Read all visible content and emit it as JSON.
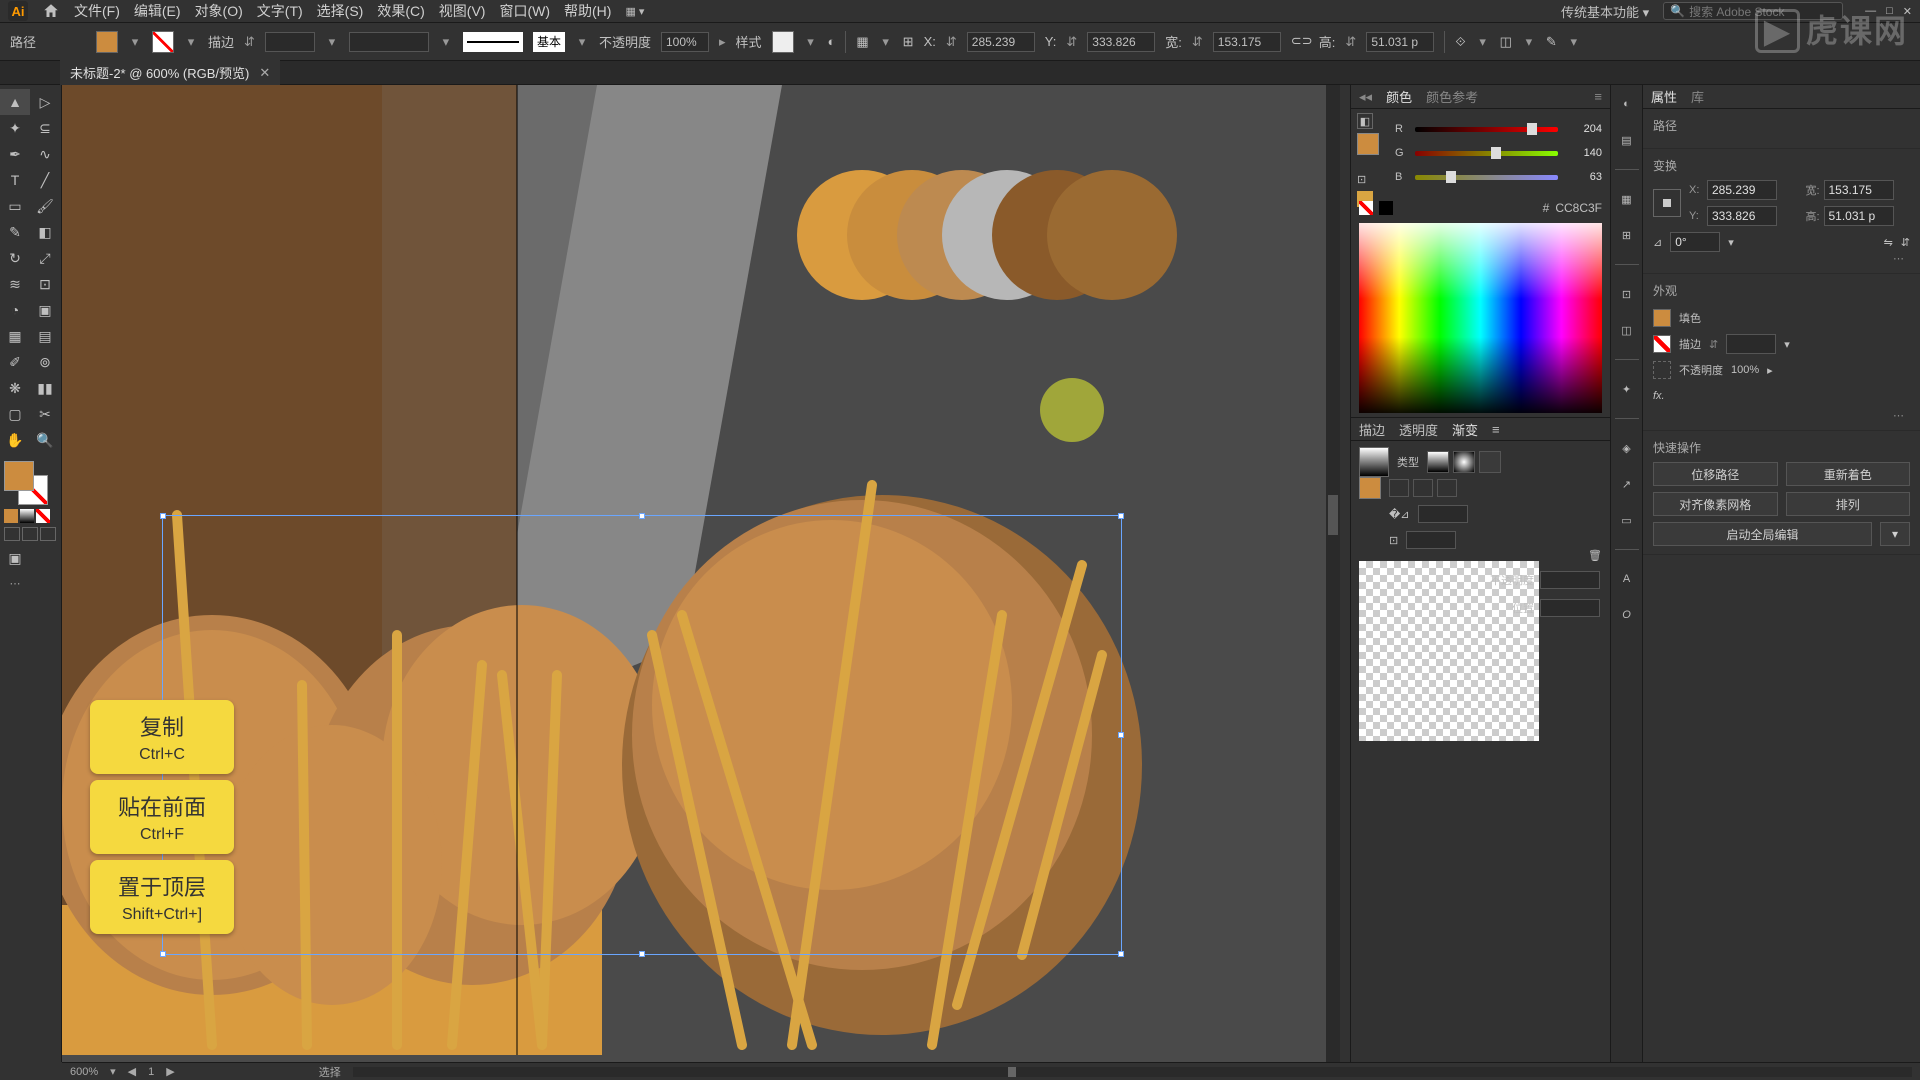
{
  "app": {
    "logo": "Ai"
  },
  "menu": [
    "文件(F)",
    "编辑(E)",
    "对象(O)",
    "文字(T)",
    "选择(S)",
    "效果(C)",
    "视图(V)",
    "窗口(W)",
    "帮助(H)"
  ],
  "workspace": "传统基本功能",
  "search_placeholder": "搜索 Adobe Stock",
  "controlbar": {
    "path_label": "路径",
    "stroke_label": "描边",
    "stroke_value": "",
    "brush_label": "基本",
    "opacity_label": "不透明度",
    "opacity_value": "100%",
    "style_label": "样式",
    "x_label": "X:",
    "x_value": "285.239",
    "y_label": "Y:",
    "y_value": "333.826",
    "w_label": "宽:",
    "w_value": "153.175",
    "h_label": "高:",
    "h_value": "51.031 p"
  },
  "tab": {
    "title": "未标题-2* @ 600% (RGB/预览)"
  },
  "color": {
    "tab1": "颜色",
    "tab2": "颜色参考",
    "r_label": "R",
    "r_value": "204",
    "g_label": "G",
    "g_value": "140",
    "b_label": "B",
    "b_value": "63",
    "hex_prefix": "#",
    "hex_value": "CC8C3F"
  },
  "gradient_tabs": {
    "t1": "描边",
    "t2": "透明度",
    "t3": "渐变"
  },
  "gradient": {
    "type_label": "类型",
    "opacity_label": "不透明度",
    "position_label": "位置"
  },
  "props": {
    "tab1": "属性",
    "tab2": "库",
    "section_path": "路径",
    "section_transform": "变换",
    "x_label": "X:",
    "x_value": "285.239",
    "y_label": "Y:",
    "y_value": "333.826",
    "w_label": "宽:",
    "w_value": "153.175",
    "h_label": "高:",
    "h_value": "51.031 p",
    "angle_value": "0°",
    "section_appearance": "外观",
    "fill_label": "填色",
    "stroke_label": "描边",
    "opacity_label": "不透明度",
    "opacity_value": "100%",
    "fx_label": "fx.",
    "section_actions": "快速操作",
    "btn_offset": "位移路径",
    "btn_recolor": "重新着色",
    "btn_pixel": "对齐像素网格",
    "btn_arrange": "排列",
    "btn_global": "启动全局编辑"
  },
  "hints": [
    {
      "title": "复制",
      "shortcut": "Ctrl+C"
    },
    {
      "title": "贴在前面",
      "shortcut": "Ctrl+F"
    },
    {
      "title": "置于顶层",
      "shortcut": "Shift+Ctrl+]"
    }
  ],
  "status": {
    "zoom": "600%",
    "nav": "1",
    "tool": "选择"
  },
  "watermark": "虎课网"
}
